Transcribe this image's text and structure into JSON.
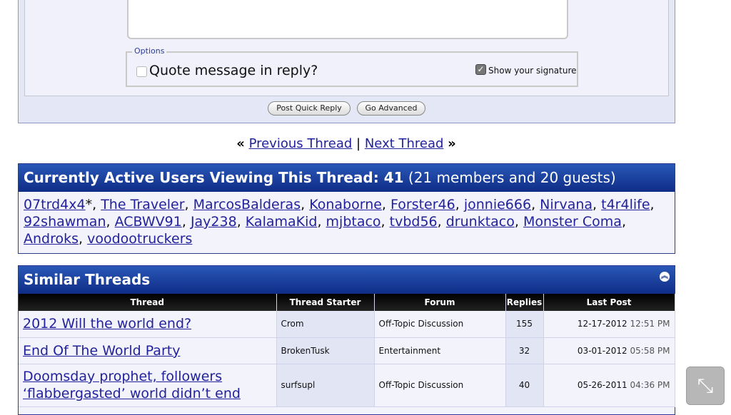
{
  "quick_reply": {
    "options_legend": "Options",
    "quote_label": "Quote message in reply?",
    "signature_label": "Show your signature",
    "signature_checked": true,
    "post_button": "Post Quick Reply",
    "advanced_button": "Go Advanced"
  },
  "thread_nav": {
    "prev_marks": "«",
    "prev": "Previous Thread",
    "sep": "|",
    "next": "Next Thread",
    "next_marks": "»"
  },
  "active_users": {
    "title_bold": "Currently Active Users Viewing This Thread: 41",
    "title_rest": " (21 members and 20 guests)",
    "users": [
      "07trd4x4",
      "The Traveler",
      "MarcosBalderas",
      "Konaborne",
      "Forster46",
      "jonnie666",
      "Nirvana",
      "t4r4life",
      "92shawman",
      "ACBWV91",
      "Jay238",
      "KalamaKid",
      "mjbtaco",
      "tvbd56",
      "drunktaco",
      "Monster Coma",
      "Androks",
      "voodootruckers"
    ],
    "first_user_suffix": "*"
  },
  "similar_threads": {
    "title": "Similar Threads",
    "columns": [
      "Thread",
      "Thread Starter",
      "Forum",
      "Replies",
      "Last Post"
    ],
    "rows": [
      {
        "thread": "2012 Will the world end?",
        "starter": "Crom",
        "forum": "Off-Topic Discussion",
        "replies": "155",
        "date": "12-17-2012",
        "time": "12:51 PM"
      },
      {
        "thread": "End Of The World Party",
        "starter": "BrokenTusk",
        "forum": "Entertainment",
        "replies": "32",
        "date": "03-01-2012",
        "time": "05:58 PM"
      },
      {
        "thread": "Doomsday prophet, followers ‘flabbergasted’ world didn’t end",
        "starter": "surfsupl",
        "forum": "Off-Topic Discussion",
        "replies": "40",
        "date": "05-26-2011",
        "time": "04:36 PM"
      }
    ]
  },
  "colors": {
    "header_blue": "#1b3c93",
    "link": "#22229c",
    "panel_bg": "#e4e7f5"
  },
  "icons": {
    "collapse": "collapse-icon",
    "shrink": "shrink-icon"
  }
}
